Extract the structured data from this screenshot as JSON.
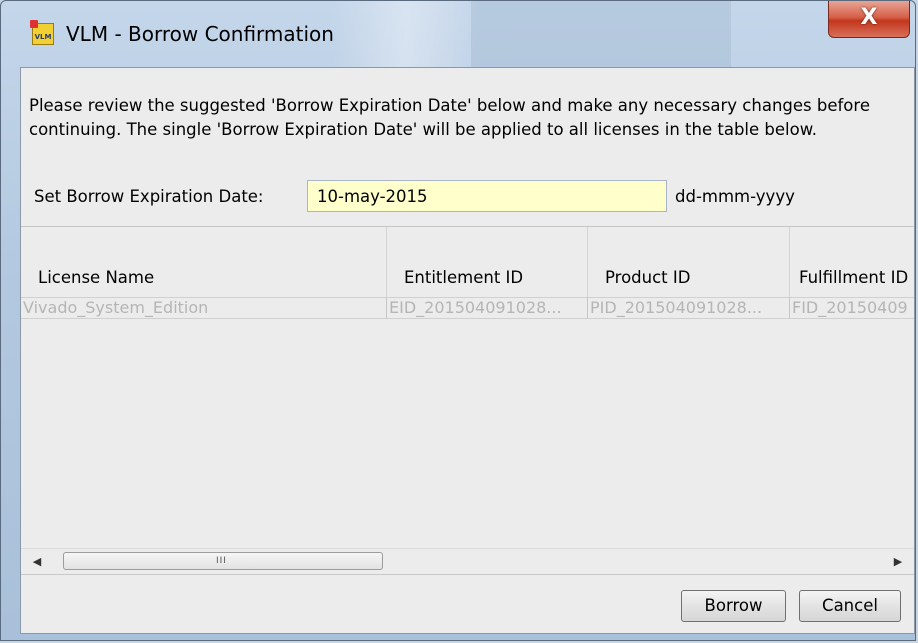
{
  "window": {
    "app_icon": "vlm-app-icon",
    "app_icon_text": "VLM",
    "title": "VLM - Borrow Confirmation",
    "close_glyph": "X"
  },
  "instructions": "Please review the suggested 'Borrow Expiration Date' below and make any necessary changes before continuing.  The single 'Borrow Expiration Date' will be applied to all licenses in the table below.",
  "date": {
    "label": "Set Borrow Expiration Date:",
    "value": "10-may-2015",
    "format": "dd-mmm-yyyy"
  },
  "table": {
    "columns": [
      "License Name",
      "Entitlement ID",
      "Product ID",
      "Fulfillment ID"
    ],
    "rows": [
      [
        "Vivado_System_Edition",
        "EID_201504091028...",
        "PID_201504091028...",
        "FID_20150409"
      ]
    ]
  },
  "scrollbar": {
    "left_arrow": "◀",
    "right_arrow": "▶",
    "grip": "III"
  },
  "buttons": {
    "borrow": "Borrow",
    "cancel": "Cancel"
  }
}
